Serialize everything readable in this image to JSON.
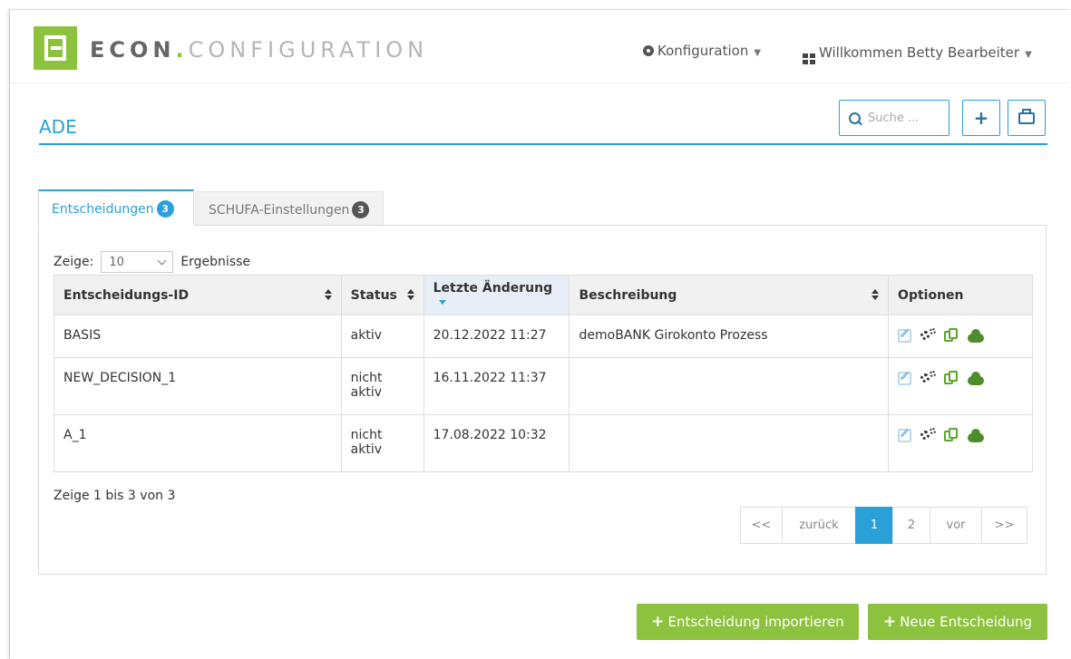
{
  "header": {
    "logo_brand": "ECON",
    "logo_dot": ".",
    "logo_suffix": "CONFIGURATION",
    "nav_config": "Konfiguration",
    "nav_user": "Willkommen Betty Bearbeiter"
  },
  "page": {
    "title": "ADE",
    "search_placeholder": "Suche ...",
    "add_label": "+"
  },
  "tabs": [
    {
      "label": "Entscheidungen",
      "count": "3"
    },
    {
      "label": "SCHUFA-Einstellungen",
      "count": "3"
    }
  ],
  "length": {
    "prefix": "Zeige:",
    "value": "10",
    "suffix": "Ergebnisse"
  },
  "table": {
    "columns": [
      "Entscheidungs-ID",
      "Status",
      "Letzte Änderung",
      "Beschreibung",
      "Optionen"
    ],
    "rows": [
      {
        "id": "BASIS",
        "status": "aktiv",
        "changed": "20.12.2022 11:27",
        "description": "demoBANK Girokonto Prozess"
      },
      {
        "id": "NEW_DECISION_1",
        "status": "nicht aktiv",
        "changed": "16.11.2022 11:37",
        "description": ""
      },
      {
        "id": "A_1",
        "status": "nicht aktiv",
        "changed": "17.08.2022 10:32",
        "description": ""
      }
    ]
  },
  "info": "Zeige 1 bis 3 von 3",
  "pagination": {
    "first": "<<",
    "prev": "zurück",
    "page1": "1",
    "page2": "2",
    "next": "vor",
    "last": ">>"
  },
  "actions": {
    "import_label": "Entscheidung importieren",
    "new_label": "Neue Entscheidung"
  },
  "colors": {
    "accent_blue": "#2aa0d8",
    "brand_green": "#8dc23f"
  }
}
